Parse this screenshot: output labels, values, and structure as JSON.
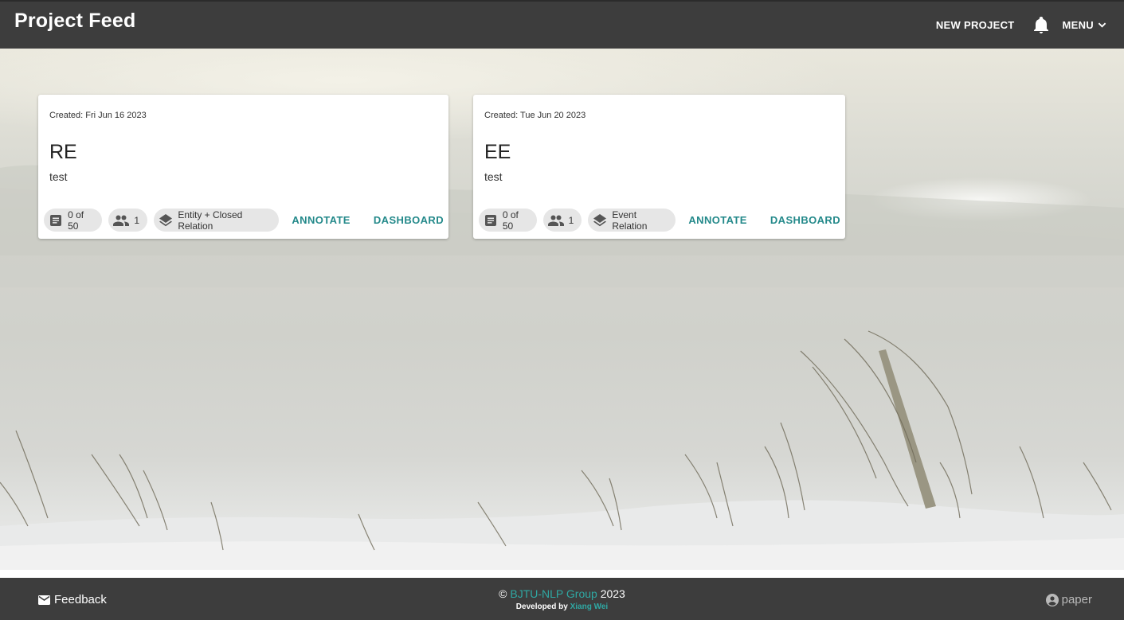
{
  "header": {
    "title": "Project Feed",
    "new_project": "NEW PROJECT",
    "menu": "MENU",
    "notification_icon": "bell-icon"
  },
  "projects": [
    {
      "created": "Created: Fri Jun 16 2023",
      "name": "RE",
      "description": "test",
      "docs": "0 of 50",
      "members": "1",
      "type": "Entity + Closed Relation",
      "annotate": "ANNOTATE",
      "dashboard": "DASHBOARD"
    },
    {
      "created": "Created: Tue Jun 20 2023",
      "name": "EE",
      "description": "test",
      "docs": "0 of 50",
      "members": "1",
      "type": "Event Relation",
      "annotate": "ANNOTATE",
      "dashboard": "DASHBOARD"
    }
  ],
  "footer": {
    "feedback": "Feedback",
    "copyright_symbol": "©",
    "group": "BJTU-NLP Group",
    "year": "2023",
    "developed_by": "Developed by",
    "developer": "Xiang Wei",
    "user": "paper"
  },
  "colors": {
    "bar": "#3d3d3d",
    "accent": "#23898a",
    "link": "#2fa8a3",
    "chip": "#e6e6e6"
  }
}
